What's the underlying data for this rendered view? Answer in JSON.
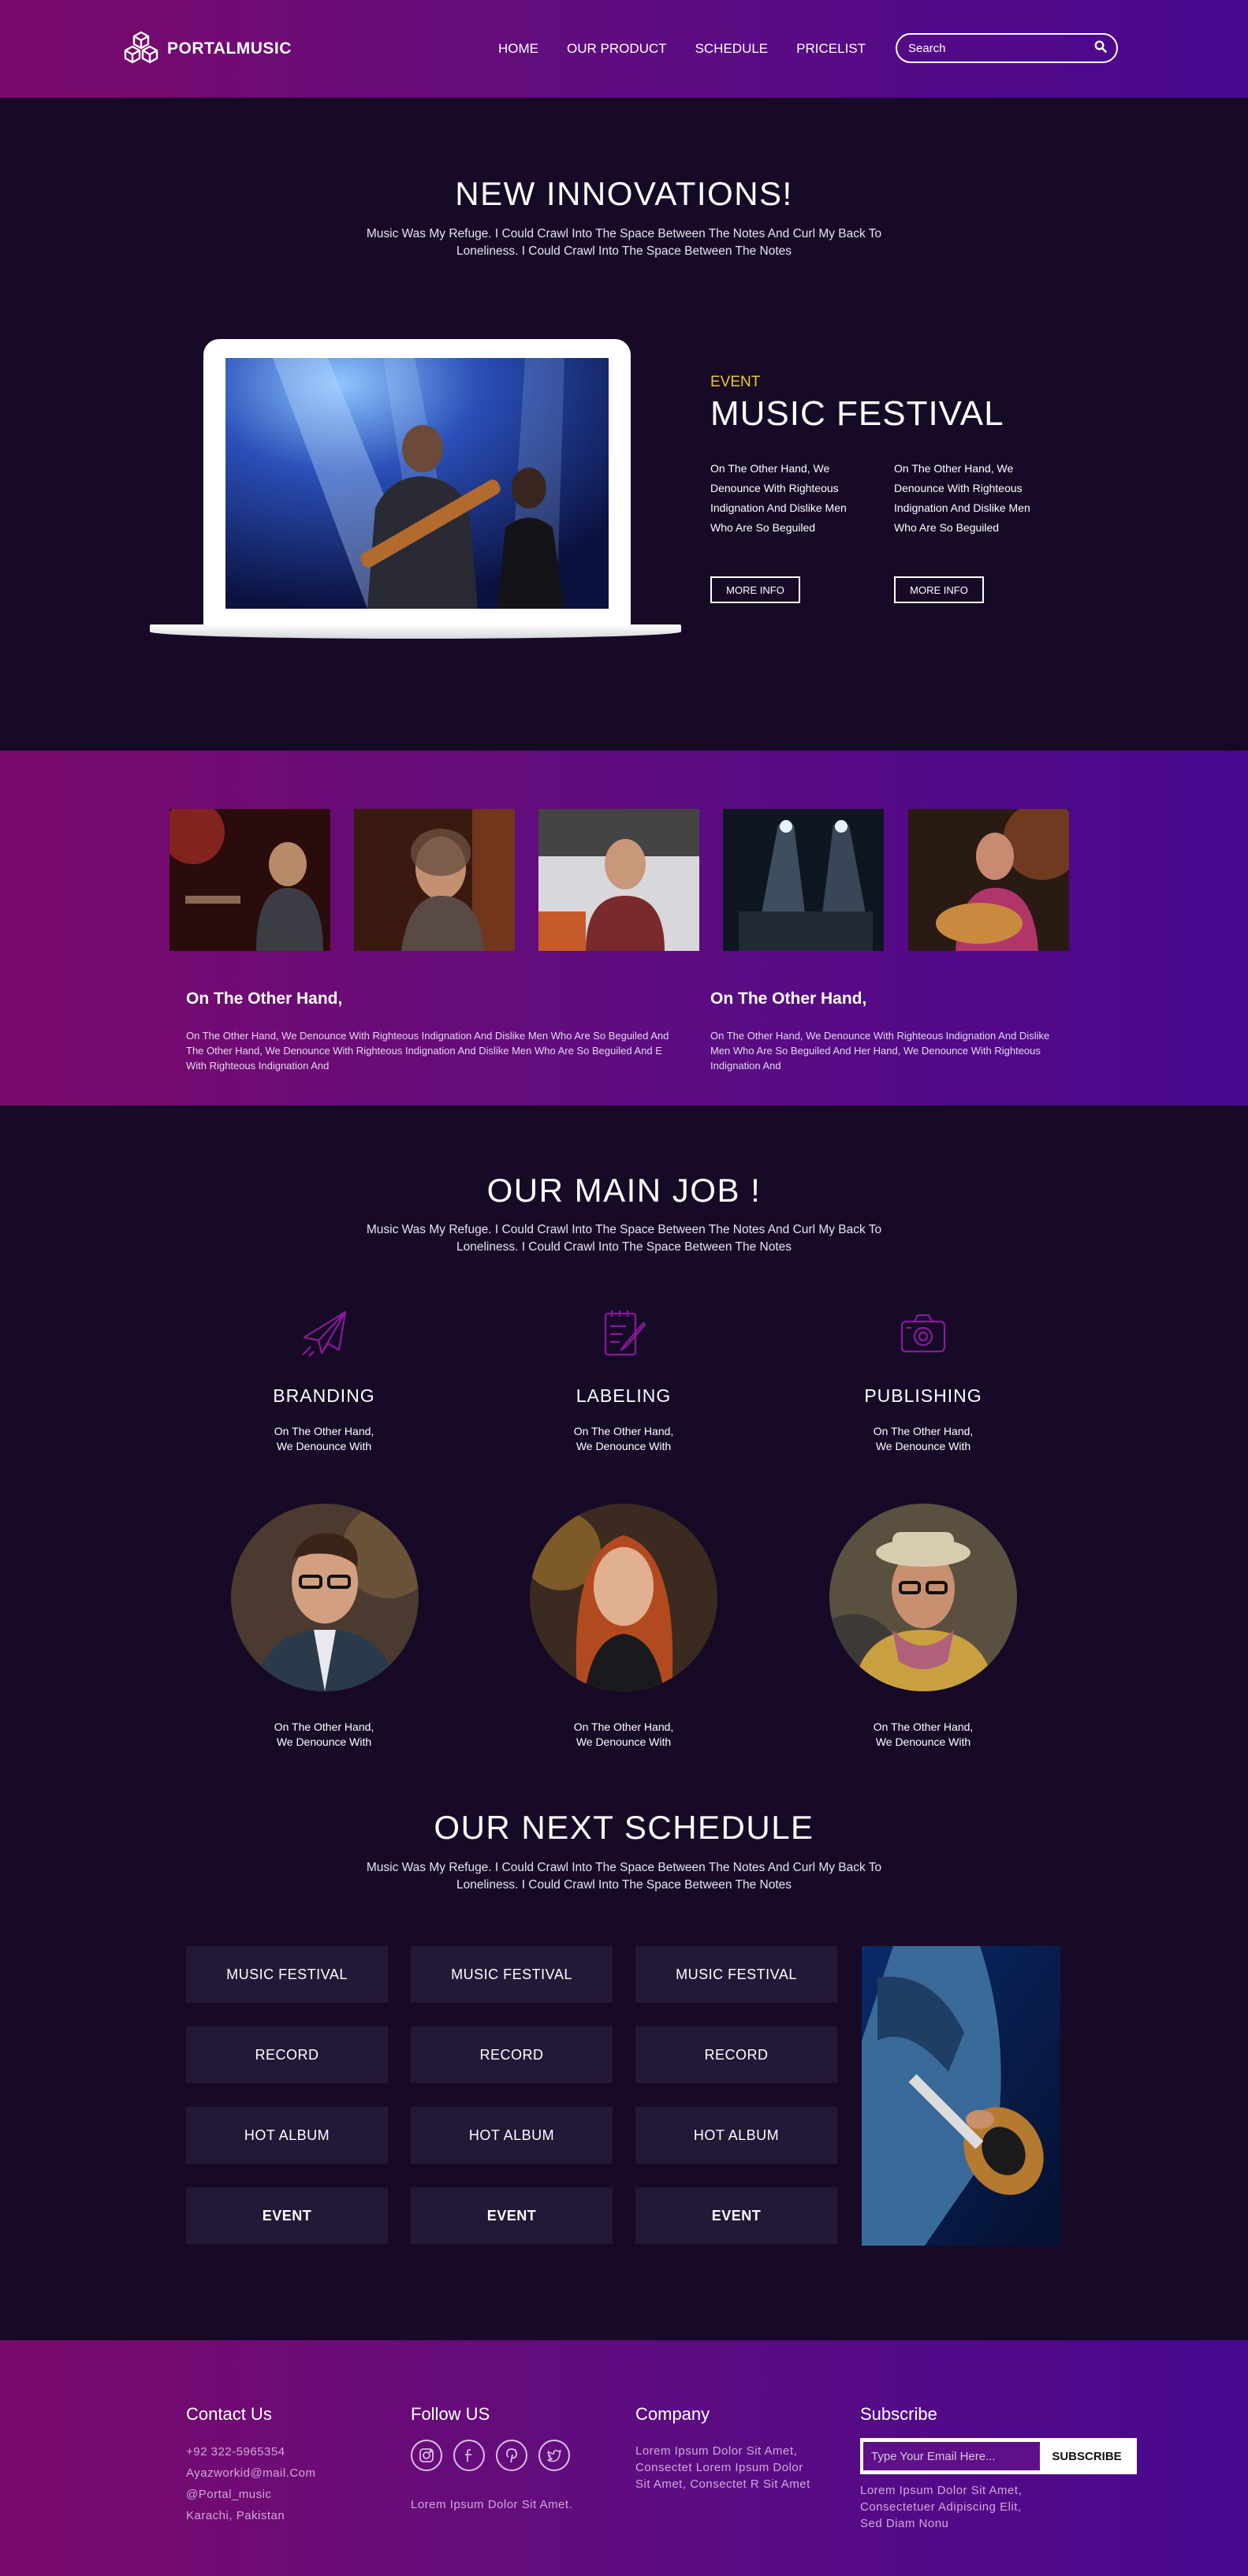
{
  "colors": {
    "background": "#170a27",
    "gradient_start": "#7a0a6b",
    "gradient_end": "#48078f",
    "accent_yellow": "#e9c92b",
    "card": "#241838"
  },
  "header": {
    "logo_text": "PORTALMUSIC",
    "logo_icon": "cubes-icon",
    "nav": [
      "HOME",
      "OUR PRODUCT",
      "SCHEDULE",
      "PRICELIST"
    ],
    "search_placeholder": "Search",
    "search_icon": "search-icon"
  },
  "innovations": {
    "title": "NEW INNOVATIONS!",
    "subtitle": "Music Was My Refuge. I Could Crawl Into The Space Between The Notes And Curl My Back To Loneliness. I Could Crawl Into The Space Between The Notes",
    "event_label": "EVENT",
    "event_title": "MUSIC FESTIVAL",
    "col1_text": "On The Other Hand, We Denounce With Righteous Indignation And Dislike Men Who Are So Beguiled",
    "col2_text": "On The Other Hand, We Denounce With Righteous Indignation And Dislike Men Who Are So Beguiled",
    "more_info_1": "MORE INFO",
    "more_info_2": "MORE INFO"
  },
  "band": {
    "left_heading": "On The Other Hand,",
    "left_text": "On The Other Hand, We Denounce With Righteous Indignation And Dislike Men Who Are So Beguiled And The Other Hand, We Denounce With Righteous Indignation And Dislike Men Who Are So Beguiled And E With Righteous Indignation And",
    "right_heading": "On The Other Hand,",
    "right_text": "On The Other Hand, We Denounce With Righteous Indignation And Dislike Men Who Are So Beguiled And Her Hand, We Denounce With Righteous Indignation And"
  },
  "main_job": {
    "title": "OUR MAIN JOB !",
    "subtitle": "Music Was My Refuge. I Could Crawl Into The Space Between The Notes And Curl My Back To Loneliness. I Could Crawl Into The Space Between The Notes",
    "services": [
      {
        "icon": "paper-plane-icon",
        "title": "BRANDING",
        "text": "On The Other Hand, We Denounce With"
      },
      {
        "icon": "notepad-pencil-icon",
        "title": "LABELING",
        "text": "On The Other Hand, We Denounce With"
      },
      {
        "icon": "camera-icon",
        "title": "PUBLISHING",
        "text": "On The Other Hand, We Denounce With"
      }
    ],
    "people": [
      {
        "text": "On The Other Hand, We Denounce With"
      },
      {
        "text": "On The Other Hand, We Denounce With"
      },
      {
        "text": "On The Other Hand, We Denounce With"
      }
    ]
  },
  "schedule": {
    "title": "OUR NEXT SCHEDULE",
    "subtitle": "Music Was My Refuge. I Could Crawl Into The Space Between The Notes And Curl My Back To Loneliness. I Could Crawl Into The Space Between The Notes",
    "rows": [
      [
        "MUSIC FESTIVAL",
        "MUSIC FESTIVAL",
        "MUSIC FESTIVAL"
      ],
      [
        "RECORD",
        "RECORD",
        "RECORD"
      ],
      [
        "HOT ALBUM",
        "HOT ALBUM",
        "HOT ALBUM"
      ],
      [
        "EVENT",
        "EVENT",
        "EVENT"
      ]
    ]
  },
  "footer": {
    "contact_title": "Contact Us",
    "contact_lines": [
      "+92 322-5965354",
      "Ayazworkid@mail.Com",
      "@Portal_music",
      "Karachi, Pakistan"
    ],
    "follow_title": "Follow US",
    "social_icons": [
      "instagram-icon",
      "facebook-icon",
      "pinterest-icon",
      "twitter-icon"
    ],
    "follow_text": "Lorem Ipsum Dolor Sit Amet.",
    "company_title": "Company",
    "company_lines": [
      "Lorem Ipsum Dolor Sit Amet,",
      "Consectet Lorem Ipsum Dolor",
      "Sit Amet, Consectet R Sit Amet"
    ],
    "subscribe_title": "Subscribe",
    "subscribe_placeholder": "Type Your Email Here...",
    "subscribe_button": "SUBSCRIBE",
    "subscribe_lines": [
      "Lorem Ipsum Dolor Sit Amet,",
      "Consectetuer Adipiscing Elit,",
      "Sed Diam Nonu"
    ]
  }
}
